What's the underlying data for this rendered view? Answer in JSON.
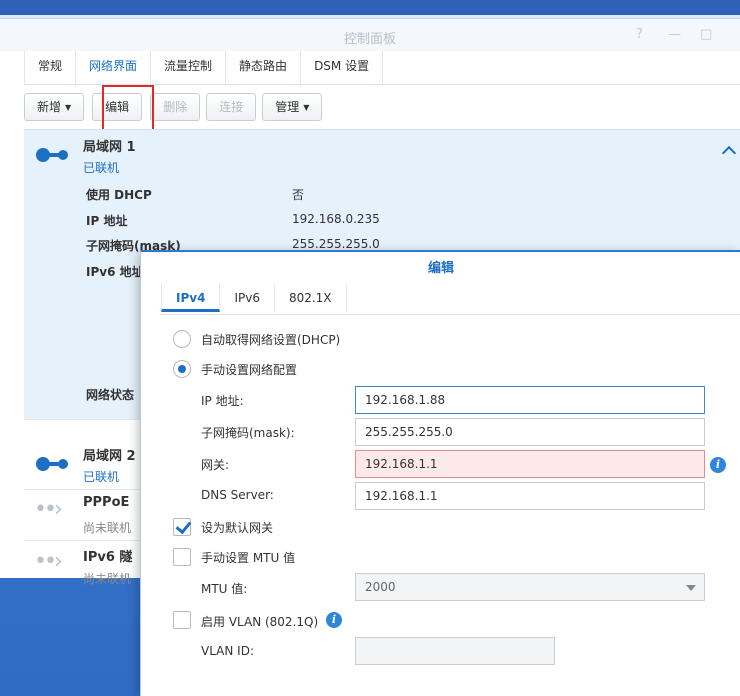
{
  "window": {
    "title": "控制面板",
    "controls": [
      "?",
      "—",
      "□"
    ]
  },
  "tabs": [
    "常规",
    "网络界面",
    "流量控制",
    "静态路由",
    "DSM 设置"
  ],
  "toolbar": {
    "create": "新增",
    "edit": "编辑",
    "delete": "删除",
    "connect": "连接",
    "manage": "管理"
  },
  "networks": [
    {
      "title": "局域网 1",
      "status": "已联机",
      "details": [
        {
          "key": "使用 DHCP",
          "value": "否"
        },
        {
          "key": "IP 地址",
          "value": "192.168.0.235"
        },
        {
          "key": "子网掩码(mask)",
          "value": "255.255.255.0"
        },
        {
          "key": "IPv6 地址",
          "value": ""
        }
      ],
      "state_label": "网络状态"
    },
    {
      "title": "局域网 2",
      "status": "已联机"
    },
    {
      "title": "PPPoE",
      "status": "尚未联机"
    },
    {
      "title": "IPv6 隧",
      "status": "尚未联机"
    }
  ],
  "dialog": {
    "title": "编辑",
    "tabs": [
      "IPv4",
      "IPv6",
      "802.1X"
    ],
    "radio_dhcp": "自动取得网络设置(DHCP)",
    "radio_manual": "手动设置网络配置",
    "ip_label": "IP 地址:",
    "ip_value": "192.168.1.88",
    "mask_label": "子网掩码(mask):",
    "mask_value": "255.255.255.0",
    "gateway_label": "网关:",
    "gateway_value": "192.168.1.1",
    "dns_label": "DNS Server:",
    "dns_value": "192.168.1.1",
    "default_gateway": "设为默认网关",
    "manual_mtu": "手动设置 MTU 值",
    "mtu_label": "MTU 值:",
    "mtu_value": "2000",
    "vlan": "启用 VLAN (802.1Q)",
    "vlan_id_label": "VLAN ID:",
    "vlan_id_value": ""
  },
  "colors": {
    "accent": "#1d6fc6",
    "highlight_row": "#e5f1fb",
    "error_field": "#fde9e9",
    "annotation_red": "#e02a2a"
  }
}
